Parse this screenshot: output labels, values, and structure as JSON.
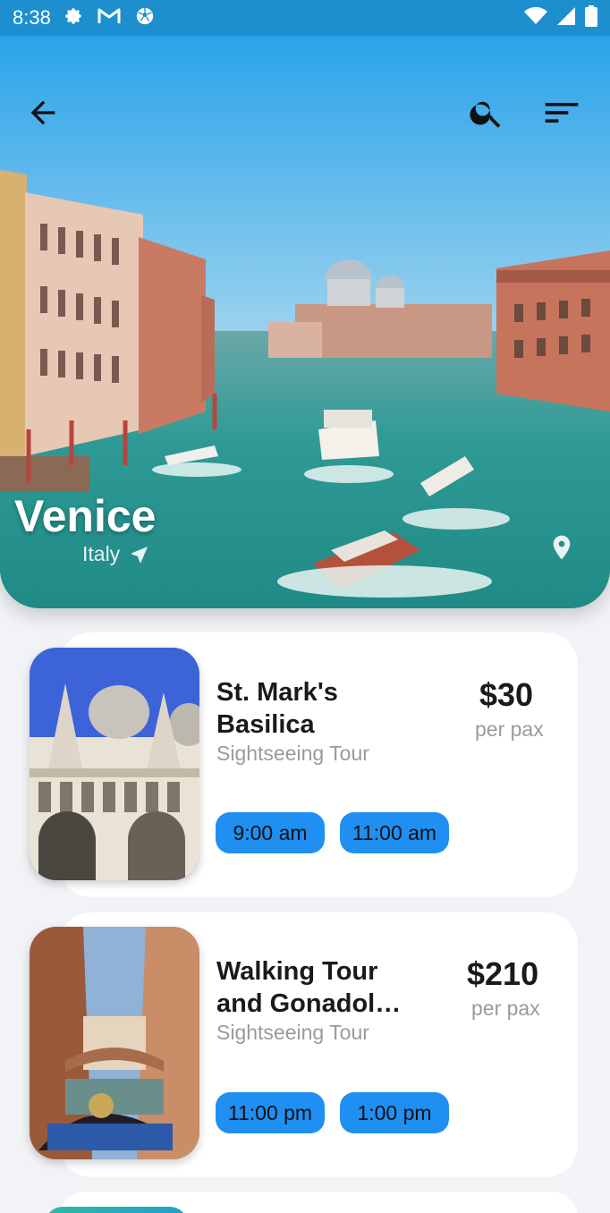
{
  "status_bar": {
    "time": "8:38"
  },
  "hero": {
    "city": "Venice",
    "country": "Italy"
  },
  "tours": [
    {
      "name_line1": "St. Mark's",
      "name_line2": "Basilica",
      "type": "Sightseeing Tour",
      "price": "$30",
      "unit": "per pax",
      "times": [
        "9:00 am",
        "11:00 am"
      ]
    },
    {
      "name_line1": "Walking Tour",
      "name_line2": "and Gonadol…",
      "type": "Sightseeing Tour",
      "price": "$210",
      "unit": "per pax",
      "times": [
        "11:00 pm",
        "1:00 pm"
      ]
    }
  ],
  "colors": {
    "accent": "#1f8ff2",
    "status_bar": "#1d8fcf"
  }
}
